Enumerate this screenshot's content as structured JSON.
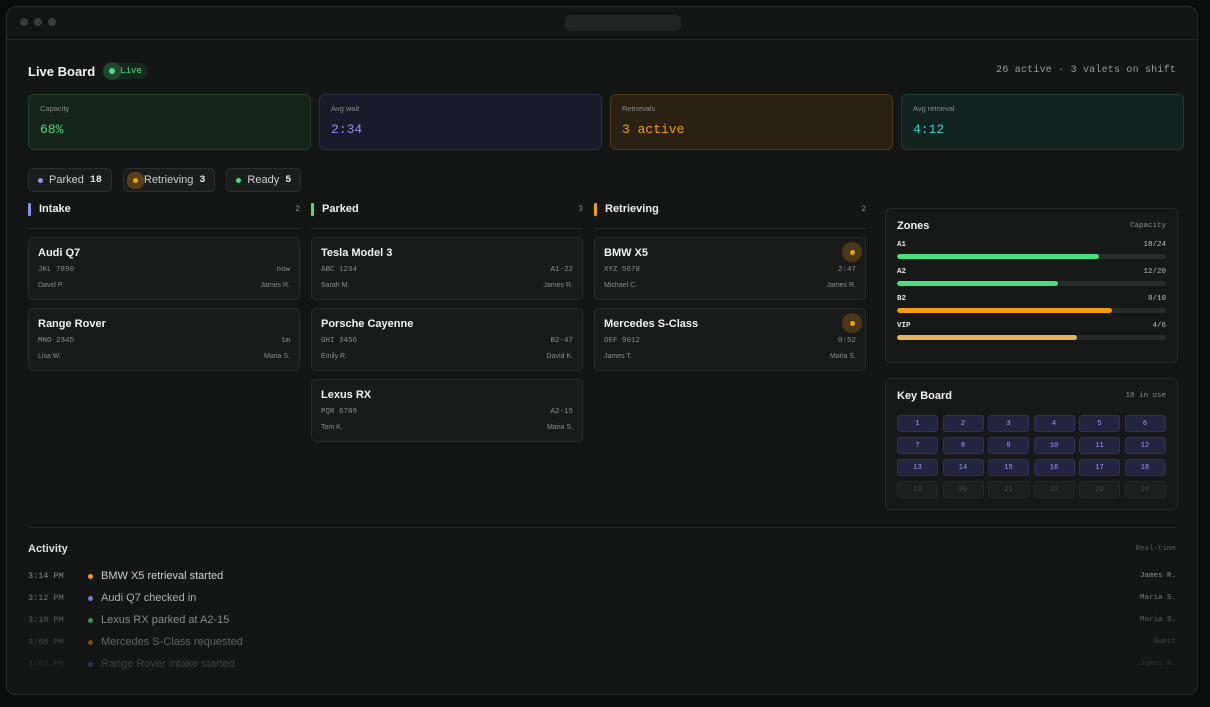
{
  "header": {
    "title": "Live Board",
    "live_label": "Live",
    "summary": "26 active · 3 valets on shift"
  },
  "stats": [
    {
      "label": "Capacity",
      "value": "68%"
    },
    {
      "label": "Avg wait",
      "value": "2:34"
    },
    {
      "label": "Retrievals",
      "value": "3 active"
    },
    {
      "label": "Avg retrieval",
      "value": "4:12"
    }
  ],
  "filters": [
    {
      "label": "Parked",
      "count": "18",
      "color": "#8b91f5"
    },
    {
      "label": "Retrieving",
      "count": "3",
      "color": "#f59e0b"
    },
    {
      "label": "Ready",
      "count": "5",
      "color": "#4ade80"
    }
  ],
  "columns": {
    "intake": {
      "title": "Intake",
      "count": "2",
      "color": "#8b91f5",
      "cards": [
        {
          "car": "Audi Q7",
          "plate": "JKL 7890",
          "meta": "now",
          "owner": "David P.",
          "valet": "James R."
        },
        {
          "car": "Range Rover",
          "plate": "MNO 2345",
          "meta": "1m",
          "owner": "Lisa W.",
          "valet": "Maria S."
        }
      ]
    },
    "parked": {
      "title": "Parked",
      "count": "3",
      "color": "#4ade80",
      "cards": [
        {
          "car": "Tesla Model 3",
          "plate": "ABC 1234",
          "meta": "A1-22",
          "owner": "Sarah M.",
          "valet": "James R."
        },
        {
          "car": "Porsche Cayenne",
          "plate": "GHI 3456",
          "meta": "B2-47",
          "owner": "Emily R.",
          "valet": "David K."
        },
        {
          "car": "Lexus RX",
          "plate": "PQR 6789",
          "meta": "A2-15",
          "owner": "Tom K.",
          "valet": "Maria S."
        }
      ]
    },
    "retrieving": {
      "title": "Retrieving",
      "count": "2",
      "color": "#f59e0b",
      "cards": [
        {
          "car": "BMW X5",
          "plate": "XYZ 5678",
          "meta": "2:47",
          "owner": "Michael C.",
          "valet": "James R."
        },
        {
          "car": "Mercedes S-Class",
          "plate": "DEF 9012",
          "meta": "0:52",
          "owner": "James T.",
          "valet": "Maria S."
        }
      ]
    }
  },
  "zones": {
    "title": "Zones",
    "meta": "Capacity",
    "items": [
      {
        "name": "A1",
        "value": "18/24",
        "fill": 0.75,
        "color": "#4ade80"
      },
      {
        "name": "A2",
        "value": "12/20",
        "fill": 0.6,
        "color": "#4ade80"
      },
      {
        "name": "B2",
        "value": "8/10",
        "fill": 0.8,
        "color": "#f59e0b"
      },
      {
        "name": "VIP",
        "value": "4/6",
        "fill": 0.67,
        "color": "#e8b45a"
      }
    ]
  },
  "keyboard": {
    "title": "Key Board",
    "meta": "18 in use",
    "keys": [
      "1",
      "2",
      "3",
      "4",
      "5",
      "6",
      "7",
      "8",
      "9",
      "10",
      "11",
      "12",
      "13",
      "14",
      "15",
      "16",
      "17",
      "18",
      "19",
      "20",
      "21",
      "22",
      "23",
      "24"
    ],
    "in_use": 18
  },
  "activity": {
    "title": "Activity",
    "meta": "Real-time",
    "items": [
      {
        "time": "3:14 PM",
        "text": "BMW X5 retrieval started",
        "who": "James R.",
        "color": "#f59e0b"
      },
      {
        "time": "3:12 PM",
        "text": "Audi Q7 checked in",
        "who": "Maria S.",
        "color": "#8b91f5"
      },
      {
        "time": "3:10 PM",
        "text": "Lexus RX parked at A2-15",
        "who": "Maria S.",
        "color": "#4ade80"
      },
      {
        "time": "3:08 PM",
        "text": "Mercedes S-Class requested",
        "who": "Guest",
        "color": "#f59e0b"
      },
      {
        "time": "3:02 PM",
        "text": "Range Rover intake started",
        "who": "James R.",
        "color": "#8b91f5"
      }
    ]
  }
}
